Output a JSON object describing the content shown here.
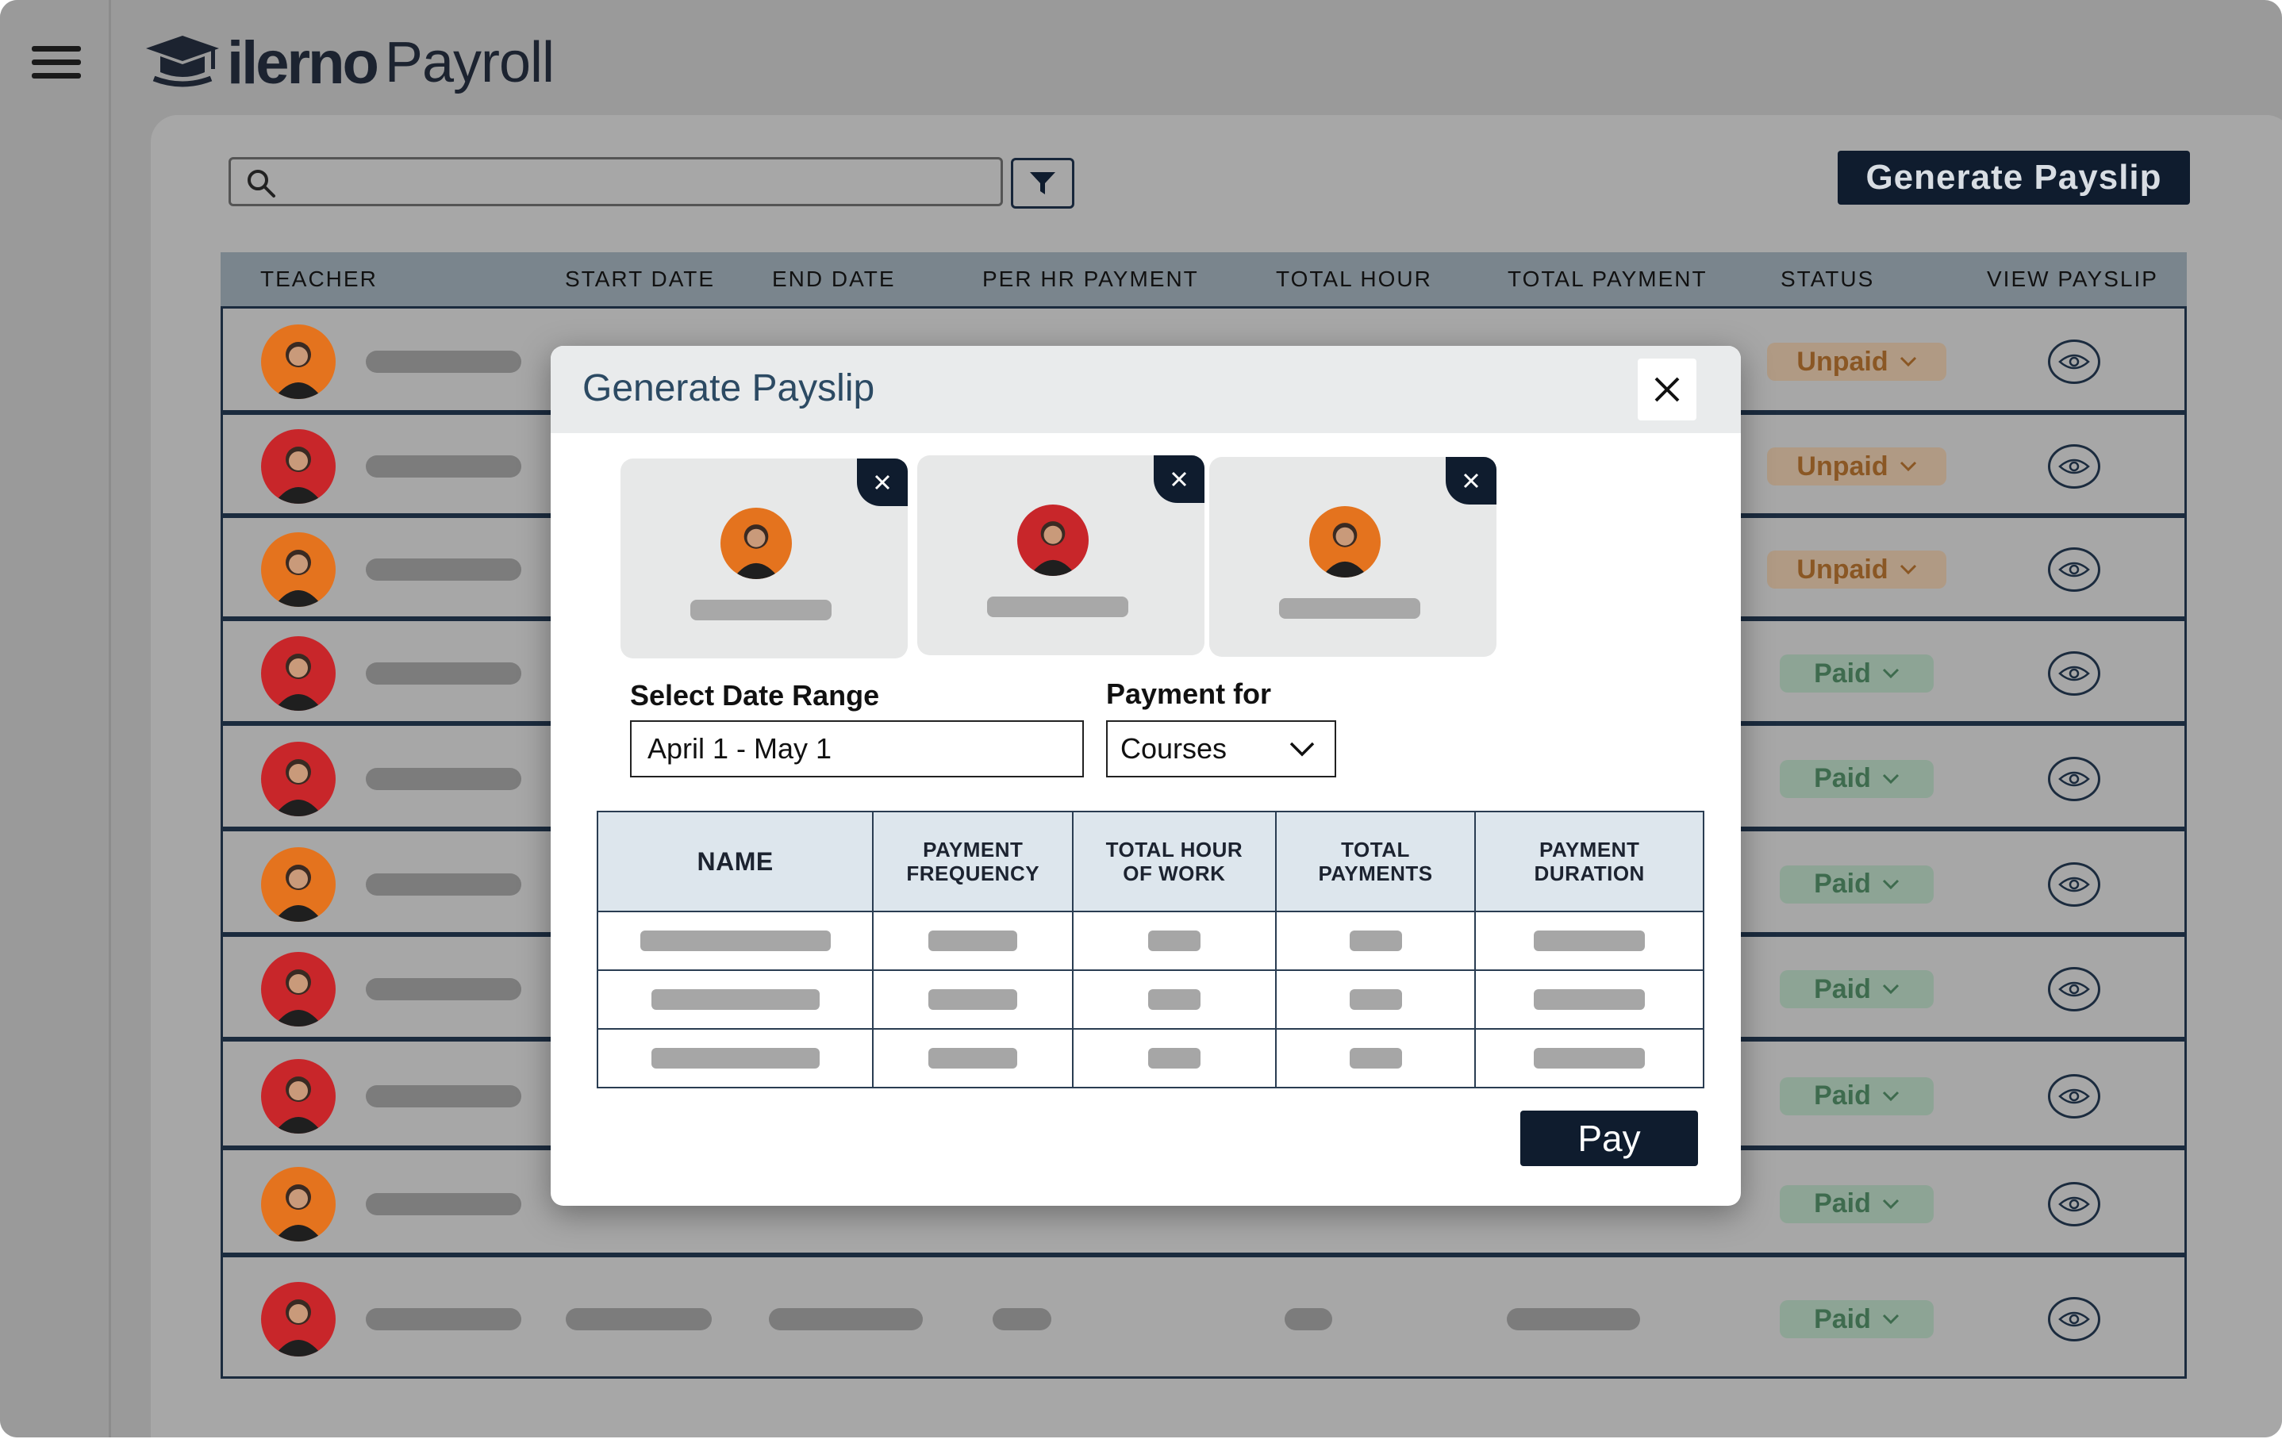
{
  "app": {
    "brand_bold": "ilerno",
    "brand_light": "Payroll"
  },
  "toolbar": {
    "search_placeholder": "",
    "generate_label": "Generate Payslip"
  },
  "table": {
    "headers": [
      "TEACHER",
      "START DATE",
      "END DATE",
      "PER HR PAYMENT",
      "TOTAL HOUR",
      "TOTAL PAYMENT",
      "STATUS",
      "VIEW PAYSLIP"
    ],
    "rows": [
      {
        "status": "Unpaid",
        "status_kind": "unpaid",
        "avatar_bg": "#e4731e"
      },
      {
        "status": "Unpaid",
        "status_kind": "unpaid",
        "avatar_bg": "#c8262a"
      },
      {
        "status": "Unpaid",
        "status_kind": "unpaid",
        "avatar_bg": "#e4731e"
      },
      {
        "status": "Paid",
        "status_kind": "paid",
        "avatar_bg": "#c8262a"
      },
      {
        "status": "Paid",
        "status_kind": "paid",
        "avatar_bg": "#c8262a"
      },
      {
        "status": "Paid",
        "status_kind": "paid",
        "avatar_bg": "#e4731e"
      },
      {
        "status": "Paid",
        "status_kind": "paid",
        "avatar_bg": "#c8262a"
      },
      {
        "status": "Paid",
        "status_kind": "paid",
        "avatar_bg": "#c8262a"
      },
      {
        "status": "Paid",
        "status_kind": "paid",
        "avatar_bg": "#e4731e"
      },
      {
        "status": "Paid",
        "status_kind": "paid",
        "avatar_bg": "#c8262a"
      }
    ]
  },
  "modal": {
    "title": "Generate Payslip",
    "date_range_label": "Select Date Range",
    "date_range_value": "April 1 - May 1",
    "payment_for_label": "Payment for",
    "payment_for_value": "Courses",
    "selected_teachers": [
      {
        "avatar_bg": "#e4731e"
      },
      {
        "avatar_bg": "#c8262a"
      },
      {
        "avatar_bg": "#e4731e"
      }
    ],
    "table_headers": {
      "name": "NAME",
      "freq_1": "PAYMENT",
      "freq_2": "FREQUENCY",
      "hours_1": "TOTAL HOUR",
      "hours_2": "OF WORK",
      "payments_1": "TOTAL",
      "payments_2": "PAYMENTS",
      "duration_1": "PAYMENT",
      "duration_2": "DURATION"
    },
    "pay_label": "Pay"
  },
  "colors": {
    "navy": "#0f1c2e",
    "unpaid_bg": "#b09a84",
    "unpaid_text": "#8a5724",
    "paid_bg": "#8da495",
    "paid_text": "#3e6b4e"
  }
}
